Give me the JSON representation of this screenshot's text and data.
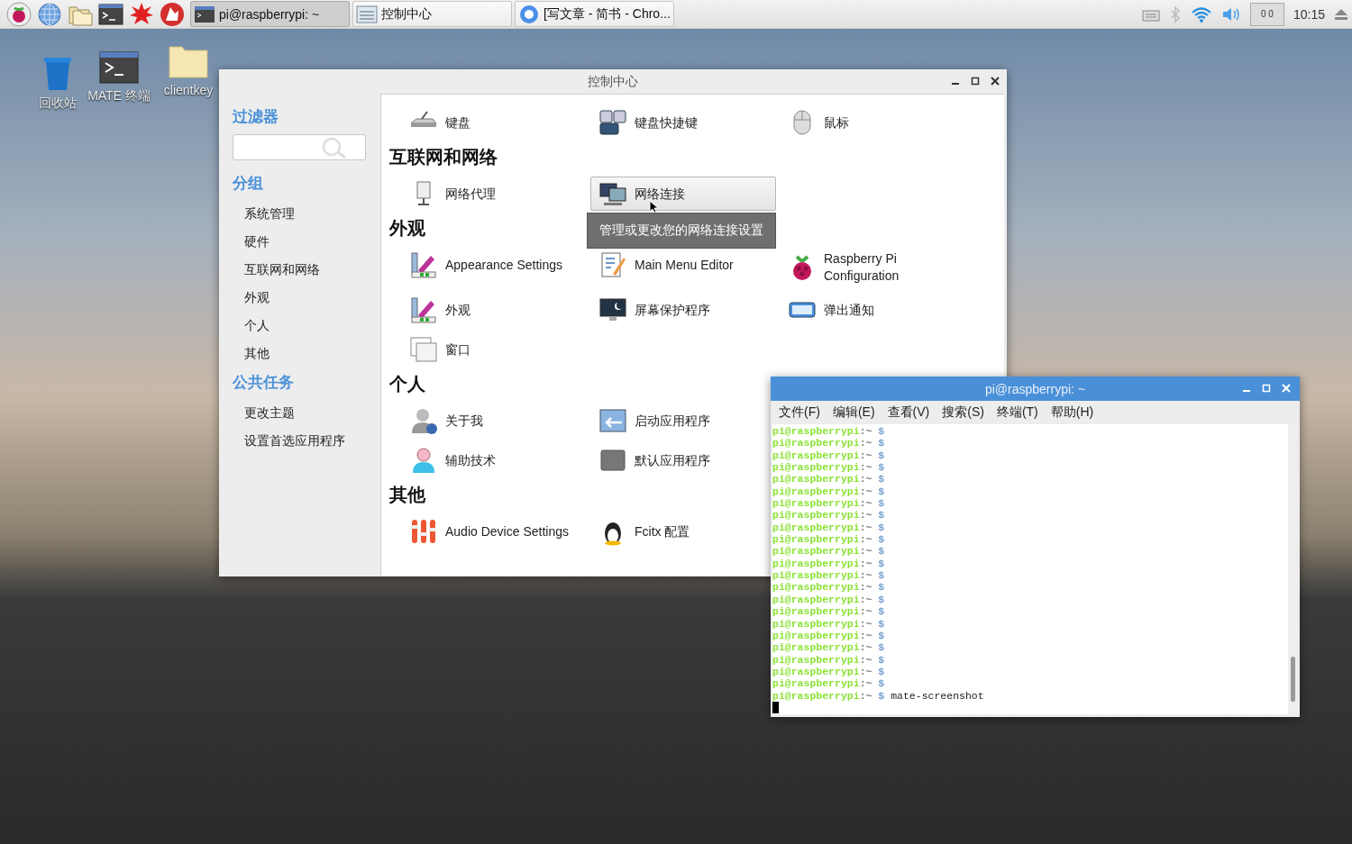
{
  "taskbar": {
    "tasks": [
      {
        "label": "pi@raspberrypi: ~",
        "selected": true
      },
      {
        "label": "控制中心",
        "selected": false
      },
      {
        "label": "[写文章 - 简书 - Chro...",
        "selected": false
      }
    ],
    "cpu_monitor": "0 0",
    "clock": "10:15"
  },
  "desktop_icons": [
    {
      "label": "回收站"
    },
    {
      "label": "MATE 终端"
    },
    {
      "label": "clientkey"
    }
  ],
  "control_center": {
    "title": "控制中心",
    "sidebar": {
      "filter_heading": "过滤器",
      "groups_heading": "分组",
      "groups": [
        "系统管理",
        "硬件",
        "互联网和网络",
        "外观",
        "个人",
        "其他"
      ],
      "tasks_heading": "公共任务",
      "tasks": [
        "更改主题",
        "设置首选应用程序"
      ]
    },
    "sections": [
      {
        "items": [
          {
            "label": "键盘",
            "hovered": false
          },
          {
            "label": "键盘快捷键",
            "hovered": false
          },
          {
            "label": "鼠标",
            "hovered": false
          }
        ]
      },
      {
        "heading": "互联网和网络",
        "items": [
          {
            "label": "网络代理",
            "hovered": false
          },
          {
            "label": "网络连接",
            "hovered": true,
            "tooltip": "管理或更改您的网络连接设置"
          }
        ]
      },
      {
        "heading": "外观",
        "items": [
          {
            "label": "Appearance Settings",
            "hovered": false
          },
          {
            "label": "Main Menu Editor",
            "hovered": false
          },
          {
            "label": "Raspberry Pi Configuration",
            "hovered": false
          },
          {
            "label": "外观",
            "hovered": false
          },
          {
            "label": "屏幕保护程序",
            "hovered": false
          },
          {
            "label": "弹出通知",
            "hovered": false
          },
          {
            "label": "窗口",
            "hovered": false
          }
        ]
      },
      {
        "heading": "个人",
        "items": [
          {
            "label": "关于我",
            "hovered": false
          },
          {
            "label": "启动应用程序",
            "hovered": false
          },
          {
            "label": "辅助技术",
            "hovered": false
          },
          {
            "label": "默认应用程序",
            "hovered": false
          }
        ]
      },
      {
        "heading": "其他",
        "items": [
          {
            "label": "Audio Device Settings",
            "hovered": false
          },
          {
            "label": "Fcitx 配置",
            "hovered": false
          }
        ]
      }
    ]
  },
  "terminal": {
    "title": "pi@raspberrypi: ~",
    "menu": [
      "文件(F)",
      "编辑(E)",
      "查看(V)",
      "搜索(S)",
      "终端(T)",
      "帮助(H)"
    ],
    "lines": [
      {
        "user": "pi@raspberrypi",
        "dir": ":~",
        "sign": "$"
      },
      {
        "user": "pi@raspberrypi",
        "dir": ":~",
        "sign": "$"
      },
      {
        "user": "pi@raspberrypi",
        "dir": ":~",
        "sign": "$"
      },
      {
        "user": "pi@raspberrypi",
        "dir": ":~",
        "sign": "$"
      },
      {
        "user": "pi@raspberrypi",
        "dir": ":~",
        "sign": "$"
      },
      {
        "user": "pi@raspberrypi",
        "dir": ":~",
        "sign": "$"
      },
      {
        "user": "pi@raspberrypi",
        "dir": ":~",
        "sign": "$"
      },
      {
        "user": "pi@raspberrypi",
        "dir": ":~",
        "sign": "$"
      },
      {
        "user": "pi@raspberrypi",
        "dir": ":~",
        "sign": "$"
      },
      {
        "user": "pi@raspberrypi",
        "dir": ":~",
        "sign": "$"
      },
      {
        "user": "pi@raspberrypi",
        "dir": ":~",
        "sign": "$"
      },
      {
        "user": "pi@raspberrypi",
        "dir": ":~",
        "sign": "$"
      },
      {
        "user": "pi@raspberrypi",
        "dir": ":~",
        "sign": "$"
      },
      {
        "user": "pi@raspberrypi",
        "dir": ":~",
        "sign": "$"
      },
      {
        "user": "pi@raspberrypi",
        "dir": ":~",
        "sign": "$"
      },
      {
        "user": "pi@raspberrypi",
        "dir": ":~",
        "sign": "$"
      },
      {
        "user": "pi@raspberrypi",
        "dir": ":~",
        "sign": "$"
      },
      {
        "user": "pi@raspberrypi",
        "dir": ":~",
        "sign": "$"
      },
      {
        "user": "pi@raspberrypi",
        "dir": ":~",
        "sign": "$"
      },
      {
        "user": "pi@raspberrypi",
        "dir": ":~",
        "sign": "$"
      },
      {
        "user": "pi@raspberrypi",
        "dir": ":~",
        "sign": "$"
      },
      {
        "user": "pi@raspberrypi",
        "dir": ":~",
        "sign": "$"
      },
      {
        "user": "pi@raspberrypi",
        "dir": ":~",
        "sign": "$",
        "command": "mate-screenshot"
      }
    ]
  }
}
